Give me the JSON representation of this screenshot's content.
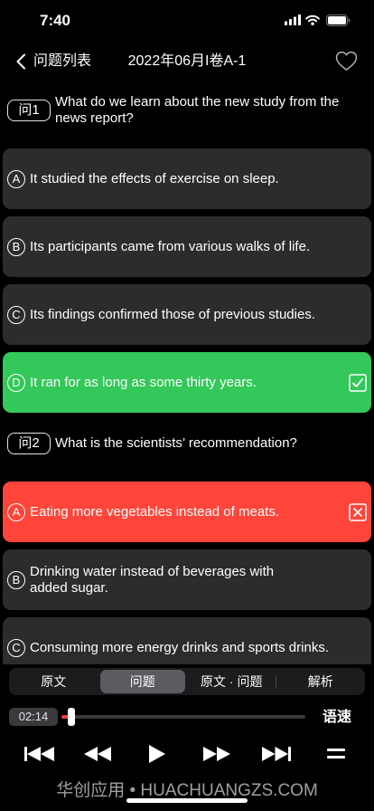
{
  "status_bar": {
    "time": "7:40",
    "battery_level": 1.0,
    "signal_icon": "cellular-signal-icon",
    "wifi_icon": "wifi-icon",
    "battery_icon": "battery-icon"
  },
  "nav": {
    "back_icon": "chevron-left-icon",
    "back_label": "问题列表",
    "title": "2022年06月I卷A-1",
    "favorite_icon": "heart-outline-icon"
  },
  "questions": [
    {
      "badge": "问1",
      "text": "What do we learn about the new study from the news report?",
      "options": [
        {
          "letter": "A",
          "text": "It studied the effects of exercise on sleep."
        },
        {
          "letter": "B",
          "text": "Its participants came from various walks of life."
        },
        {
          "letter": "C",
          "text": "Its findings confirmed those of previous studies."
        },
        {
          "letter": "D",
          "text": "It ran for as long as some thirty years.",
          "fill": "#34c759",
          "mark_icon": "check-box-icon"
        }
      ]
    },
    {
      "badge": "问2",
      "text": "What is the scientists’ recommendation?",
      "options": [
        {
          "letter": "A",
          "text": "Eating more vegetables instead of meats.",
          "fill": "#ff453a",
          "mark_icon": "x-box-icon"
        },
        {
          "letter": "B",
          "text": "Drinking water instead of beverages with\nadded sugar."
        },
        {
          "letter": "C",
          "text": "Consuming more energy drinks and sports drinks."
        }
      ]
    }
  ],
  "tabs": [
    {
      "label": "原文",
      "selected": false
    },
    {
      "label": "问题",
      "selected": true
    },
    {
      "label": "原文 · 问题",
      "selected": false
    },
    {
      "label": "解析",
      "selected": false
    }
  ],
  "player": {
    "current_time": "02:14",
    "progress": 0.04,
    "speed_label": "语速",
    "control_icons": [
      "skip-to-start-icon",
      "rewind-icon",
      "play-icon",
      "fast-forward-icon",
      "skip-to-end-icon",
      "menu-icon"
    ]
  },
  "watermark": "华创应用 • HUACHUANGZS.COM",
  "colors": {
    "background": "#000000",
    "card": "#2c2c2e",
    "segment_bg": "#1c1c1e",
    "segment_selected": "#5c5c60",
    "track": "#3a3a3c",
    "progress": "#ff3b30"
  }
}
